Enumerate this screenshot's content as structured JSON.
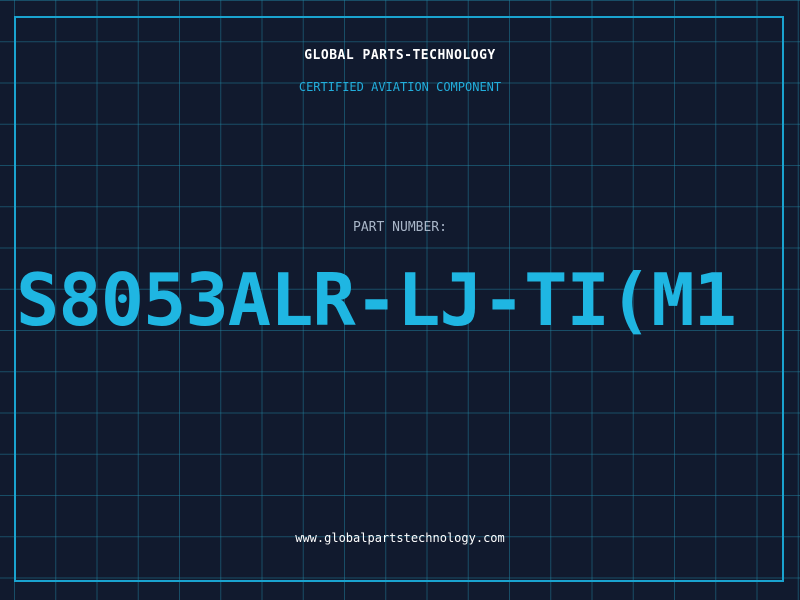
{
  "header": {
    "company": "GLOBAL PARTS-TECHNOLOGY",
    "subtitle": "CERTIFIED AVIATION COMPONENT"
  },
  "part": {
    "label": "PART NUMBER:",
    "number": "S8053ALR-LJ-TI(M1"
  },
  "footer": {
    "url": "www.globalpartstechnology.com"
  },
  "colors": {
    "background": "#111a2e",
    "accent": "#1fb6e2",
    "grid": "#1d6f88"
  }
}
